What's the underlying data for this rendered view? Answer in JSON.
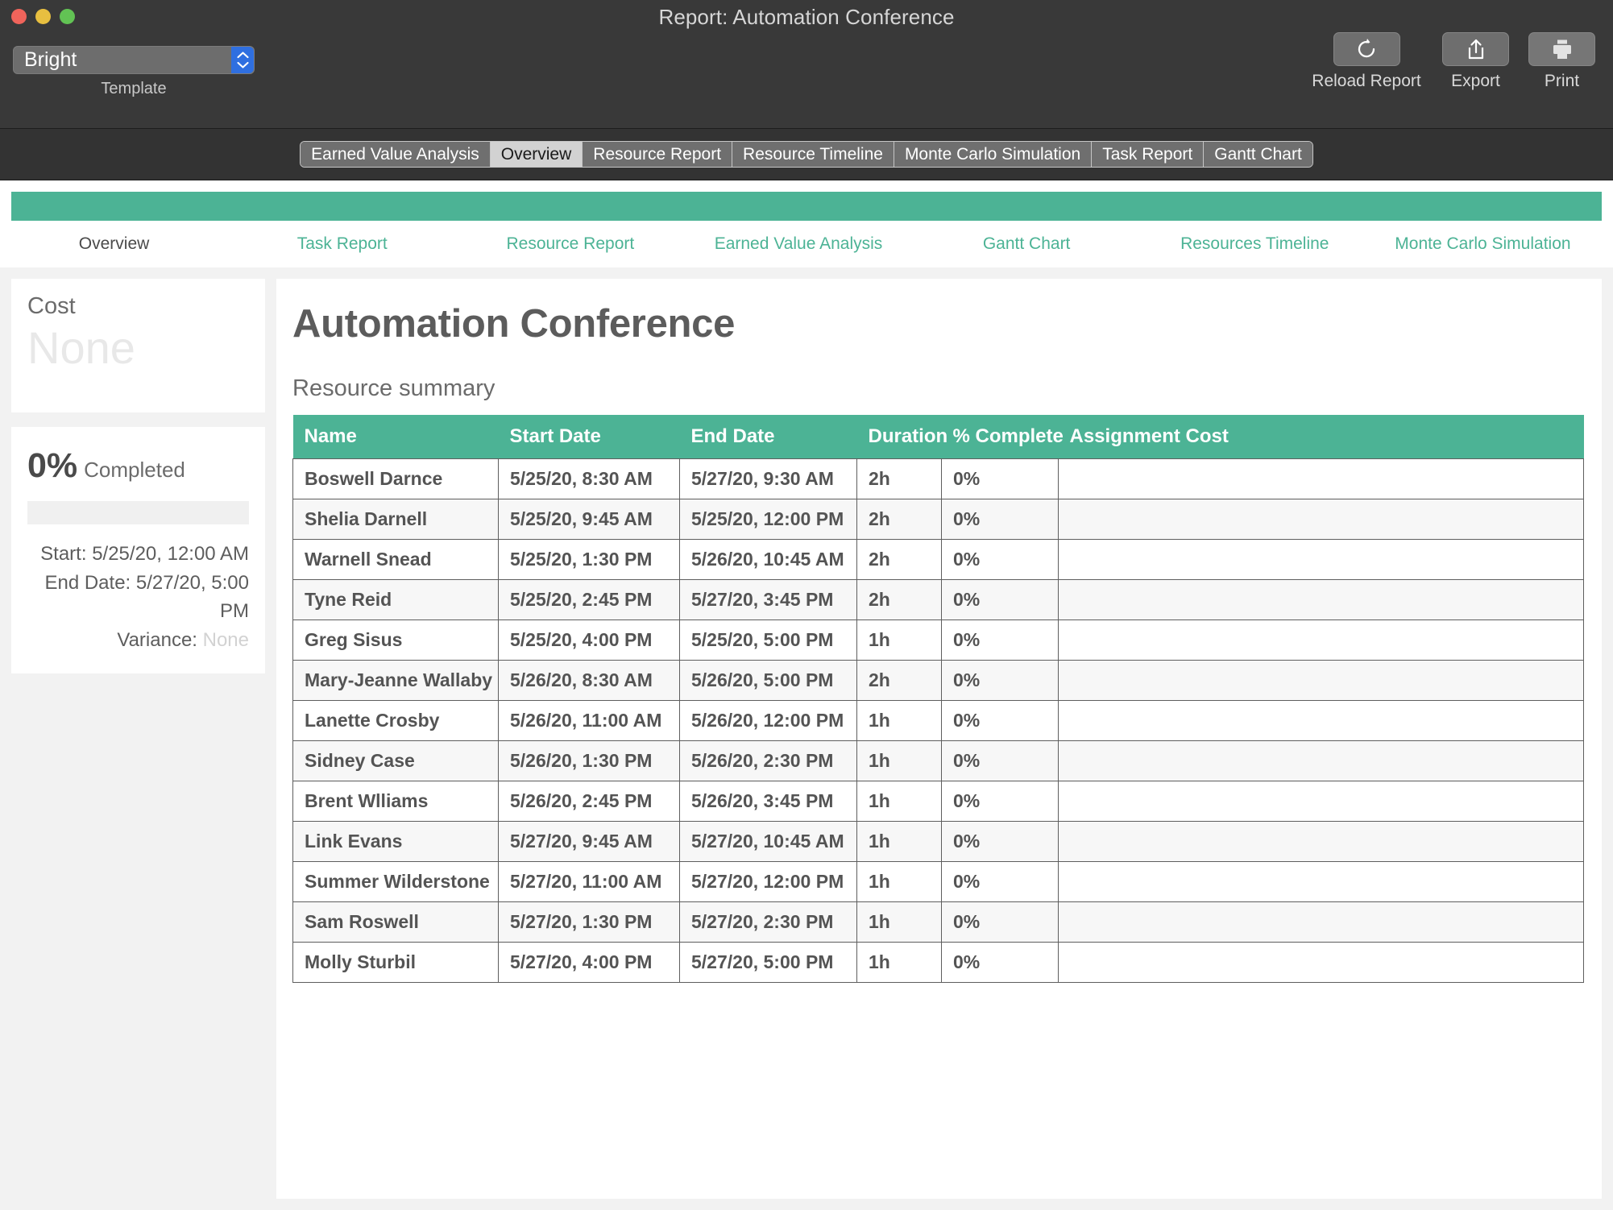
{
  "window": {
    "title": "Report: Automation Conference",
    "traffic_lights": [
      "close",
      "minimize",
      "maximize"
    ]
  },
  "toolbar": {
    "template": {
      "label": "Template",
      "selected": "Bright",
      "options": [
        "Bright"
      ]
    },
    "buttons": [
      {
        "name": "reload-report",
        "label": "Reload Report",
        "icon": "reload-icon"
      },
      {
        "name": "export",
        "label": "Export",
        "icon": "share-export-icon"
      },
      {
        "name": "print",
        "label": "Print",
        "icon": "printer-icon"
      }
    ]
  },
  "segmented_tabs": {
    "selected": "Overview",
    "items": [
      "Earned Value Analysis",
      "Overview",
      "Resource Report",
      "Resource Timeline",
      "Monte Carlo Simulation",
      "Task Report",
      "Gantt Chart"
    ]
  },
  "report": {
    "accent_color": "#4cb395",
    "nav": {
      "current": "Overview",
      "items": [
        "Overview",
        "Task Report",
        "Resource Report",
        "Earned Value Analysis",
        "Gantt Chart",
        "Resources Timeline",
        "Monte Carlo Simulation"
      ]
    },
    "title": "Automation Conference",
    "section_title": "Resource summary",
    "sidebar": {
      "cost": {
        "label": "Cost",
        "value": "None"
      },
      "progress": {
        "percent_label": "0%",
        "percent_value": 0,
        "completed_label": "Completed",
        "start_label": "Start:",
        "start_value": "5/25/20, 12:00 AM",
        "end_label": "End Date:",
        "end_value": "5/27/20, 5:00 PM",
        "variance_label": "Variance:",
        "variance_value": "None"
      }
    },
    "table": {
      "columns": [
        "Name",
        "Start Date",
        "End Date",
        "Duration",
        "% Complete",
        "Assignment Cost"
      ],
      "rows": [
        {
          "name": "Boswell Darnce",
          "start": "5/25/20, 8:30 AM",
          "end": "5/27/20, 9:30 AM",
          "duration": "2h",
          "complete": "0%",
          "cost": ""
        },
        {
          "name": "Shelia Darnell",
          "start": "5/25/20, 9:45 AM",
          "end": "5/25/20, 12:00 PM",
          "duration": "2h",
          "complete": "0%",
          "cost": ""
        },
        {
          "name": "Warnell Snead",
          "start": "5/25/20, 1:30 PM",
          "end": "5/26/20, 10:45 AM",
          "duration": "2h",
          "complete": "0%",
          "cost": ""
        },
        {
          "name": "Tyne Reid",
          "start": "5/25/20, 2:45 PM",
          "end": "5/27/20, 3:45 PM",
          "duration": "2h",
          "complete": "0%",
          "cost": ""
        },
        {
          "name": "Greg Sisus",
          "start": "5/25/20, 4:00 PM",
          "end": "5/25/20, 5:00 PM",
          "duration": "1h",
          "complete": "0%",
          "cost": ""
        },
        {
          "name": "Mary-Jeanne Wallaby",
          "start": "5/26/20, 8:30 AM",
          "end": "5/26/20, 5:00 PM",
          "duration": "2h",
          "complete": "0%",
          "cost": ""
        },
        {
          "name": "Lanette Crosby",
          "start": "5/26/20, 11:00 AM",
          "end": "5/26/20, 12:00 PM",
          "duration": "1h",
          "complete": "0%",
          "cost": ""
        },
        {
          "name": "Sidney Case",
          "start": "5/26/20, 1:30 PM",
          "end": "5/26/20, 2:30 PM",
          "duration": "1h",
          "complete": "0%",
          "cost": ""
        },
        {
          "name": "Brent Wlliams",
          "start": "5/26/20, 2:45 PM",
          "end": "5/26/20, 3:45 PM",
          "duration": "1h",
          "complete": "0%",
          "cost": ""
        },
        {
          "name": "Link Evans",
          "start": "5/27/20, 9:45 AM",
          "end": "5/27/20, 10:45 AM",
          "duration": "1h",
          "complete": "0%",
          "cost": ""
        },
        {
          "name": "Summer Wilderstone",
          "start": "5/27/20, 11:00 AM",
          "end": "5/27/20, 12:00 PM",
          "duration": "1h",
          "complete": "0%",
          "cost": ""
        },
        {
          "name": "Sam Roswell",
          "start": "5/27/20, 1:30 PM",
          "end": "5/27/20, 2:30 PM",
          "duration": "1h",
          "complete": "0%",
          "cost": ""
        },
        {
          "name": "Molly Sturbil",
          "start": "5/27/20, 4:00 PM",
          "end": "5/27/20, 5:00 PM",
          "duration": "1h",
          "complete": "0%",
          "cost": ""
        }
      ]
    }
  }
}
